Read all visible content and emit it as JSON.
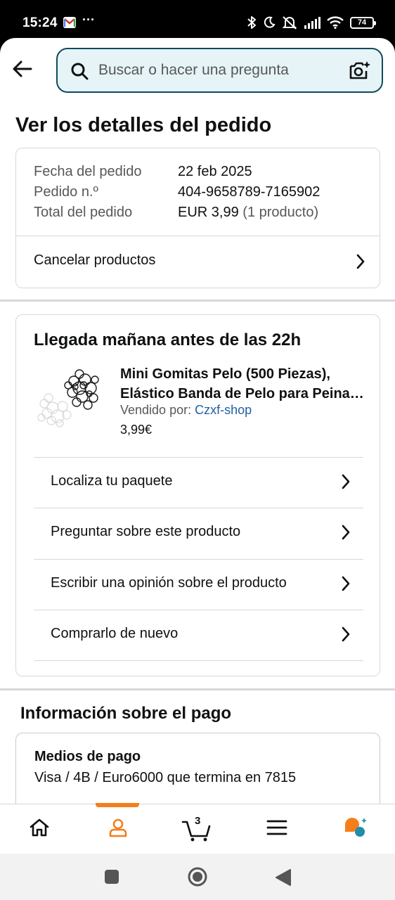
{
  "status_bar": {
    "time": "15:24",
    "more": "···",
    "battery": "74",
    "icons": [
      "gmail-icon",
      "bluetooth-icon",
      "moon-icon",
      "mute-icon",
      "signal-icon",
      "wifi-icon",
      "battery-icon"
    ]
  },
  "header": {
    "search_placeholder": "Buscar o hacer una pregunta"
  },
  "page": {
    "title": "Ver los detalles del pedido"
  },
  "summary": {
    "rows": [
      {
        "label": "Fecha del pedido",
        "value": "22 feb 2025"
      },
      {
        "label": "Pedido n.º",
        "value": "404-9658789-7165902"
      },
      {
        "label": "Total del pedido",
        "value": "EUR 3,99",
        "extra": "(1 producto)"
      }
    ],
    "cancel_label": "Cancelar productos"
  },
  "shipment": {
    "title": "Llegada mañana antes de las 22h",
    "product": {
      "name_line1": "Mini Gomitas Pelo (500 Piezas),",
      "name_line2": "Elástico Banda de Pelo para Peinados",
      "sold_by_label": "Vendido por:",
      "seller": "Czxf-shop",
      "price": "3,99€"
    },
    "actions": [
      {
        "label": "Localiza tu paquete"
      },
      {
        "label": "Preguntar sobre este producto"
      },
      {
        "label": "Escribir una opinión sobre el producto"
      },
      {
        "label": "Comprarlo de nuevo"
      }
    ]
  },
  "payment": {
    "title": "Información sobre el pago",
    "method_label": "Medios de pago",
    "method_value": "Visa / 4B / Euro6000 que termina en 7815"
  },
  "bottom_nav": {
    "cart_count": "3",
    "active": "account",
    "accent_color": "#f47f1a",
    "items": [
      "home-icon",
      "account-icon",
      "cart-icon",
      "menu-icon",
      "rufus-icon"
    ]
  },
  "colors": {
    "search_bg": "#e6f3f7",
    "search_border": "#0e4b5b",
    "link": "#2162a1",
    "divider": "#d5d9d9"
  }
}
